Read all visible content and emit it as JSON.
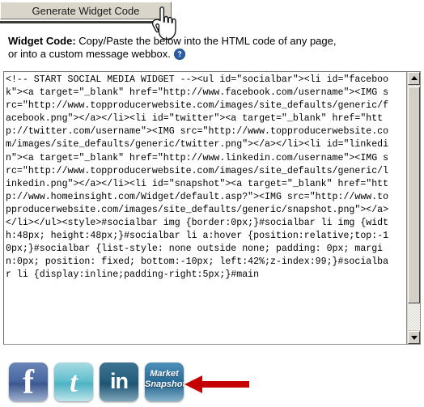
{
  "toolbar": {
    "generate_button_label": "Generate Widget Code"
  },
  "cursor": {
    "icon": "pointing-hand-cursor"
  },
  "description": {
    "label": "Widget Code:",
    "line1": " Copy/Paste the below into the HTML code of any page,",
    "line2": "or into a custom message webbox.",
    "help_icon": "help-question-icon"
  },
  "code_box": {
    "value": "<!-- START SOCIAL MEDIA WIDGET --><ul id=\"socialbar\"><li id=\"facebook\"><a target=\"_blank\" href=\"http://www.facebook.com/username\"><IMG src=\"http://www.topproducerwebsite.com/images/site_defaults/generic/facebook.png\"></a></li><li id=\"twitter\"><a target=\"_blank\" href=\"http://twitter.com/username\"><IMG src=\"http://www.topproducerwebsite.com/images/site_defaults/generic/twitter.png\"></a></li><li id=\"linkedin\"><a target=\"_blank\" href=\"http://www.linkedin.com/username\"><IMG src=\"http://www.topproducerwebsite.com/images/site_defaults/generic/linkedin.png\"></a></li><li id=\"snapshot\"><a target=\"_blank\" href=\"http://www.homeinsight.com/Widget/default.asp?\"><IMG src=\"http://www.topproducerwebsite.com/images/site_defaults/generic/snapshot.png\"></a></li></ul><style>#socialbar img {border:0px;}#socialbar li img {width:48px; height:48px;}#socialbar li a:hover {position:relative;top:-10px;}#socialbar {list-style: none outside none; padding: 0px; margin:0px; position: fixed; bottom:-10px; left:42%;z-index:99;}#socialbar li {display:inline;padding-right:5px;}#main",
    "scrollbar": {
      "up_arrow": "scroll-up-arrow-icon",
      "down_arrow": "scroll-down-arrow-icon"
    }
  },
  "social_icons": [
    {
      "name": "facebook",
      "glyph": "f",
      "color": "#4a6aa3"
    },
    {
      "name": "twitter",
      "glyph": "t",
      "color": "#63c0cf"
    },
    {
      "name": "linkedin",
      "glyph": "in",
      "color": "#255f7e"
    },
    {
      "name": "snapshot",
      "line1": "Market",
      "line2": "Snapshot",
      "color": "#2d6f9b"
    }
  ],
  "annotation": {
    "arrow": "red-left-arrow",
    "color": "#c40000"
  }
}
